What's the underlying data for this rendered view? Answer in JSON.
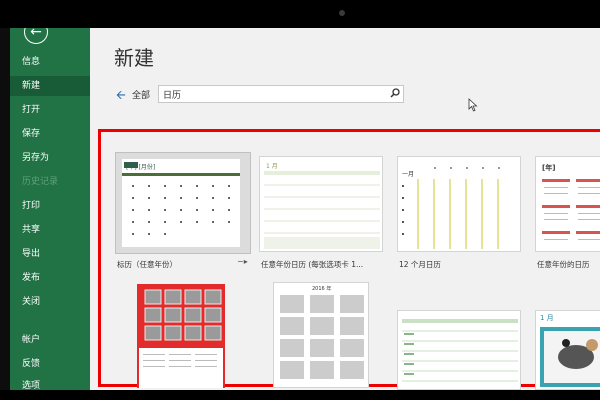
{
  "sidebar": {
    "back_icon": "arrow-left-circle-icon",
    "items": [
      {
        "label": "信息",
        "state": "normal"
      },
      {
        "label": "新建",
        "state": "active"
      },
      {
        "label": "打开",
        "state": "normal"
      },
      {
        "label": "保存",
        "state": "normal"
      },
      {
        "label": "另存为",
        "state": "normal"
      },
      {
        "label": "历史记录",
        "state": "disabled"
      },
      {
        "label": "打印",
        "state": "normal"
      },
      {
        "label": "共享",
        "state": "normal"
      },
      {
        "label": "导出",
        "state": "normal"
      },
      {
        "label": "发布",
        "state": "normal"
      },
      {
        "label": "关闭",
        "state": "normal"
      },
      {
        "label": "帐户",
        "state": "normal"
      },
      {
        "label": "反馈",
        "state": "normal"
      },
      {
        "label": "选项",
        "state": "normal"
      }
    ]
  },
  "main": {
    "title": "新建",
    "breadcrumb": "全部",
    "search_value": "日历",
    "colors": {
      "accent": "#217346",
      "active": "#185c37",
      "highlight": "#e00000"
    }
  },
  "templates": [
    {
      "caption": "标历（任意年份）",
      "header": "[年]  [月份]",
      "selected": true
    },
    {
      "caption": "任意年份日历 (每张选项卡 1...",
      "header": "1 月",
      "selected": false
    },
    {
      "caption": "12 个月日历",
      "header": "一月",
      "selected": false
    },
    {
      "caption": "任意年份的日历",
      "header": "[年]",
      "selected": false
    },
    {
      "caption": "",
      "header": "",
      "selected": false
    },
    {
      "caption": "",
      "header": "2016 年",
      "selected": false
    },
    {
      "caption": "",
      "header": "",
      "selected": false
    },
    {
      "caption": "",
      "header": "1 月",
      "selected": false
    }
  ]
}
